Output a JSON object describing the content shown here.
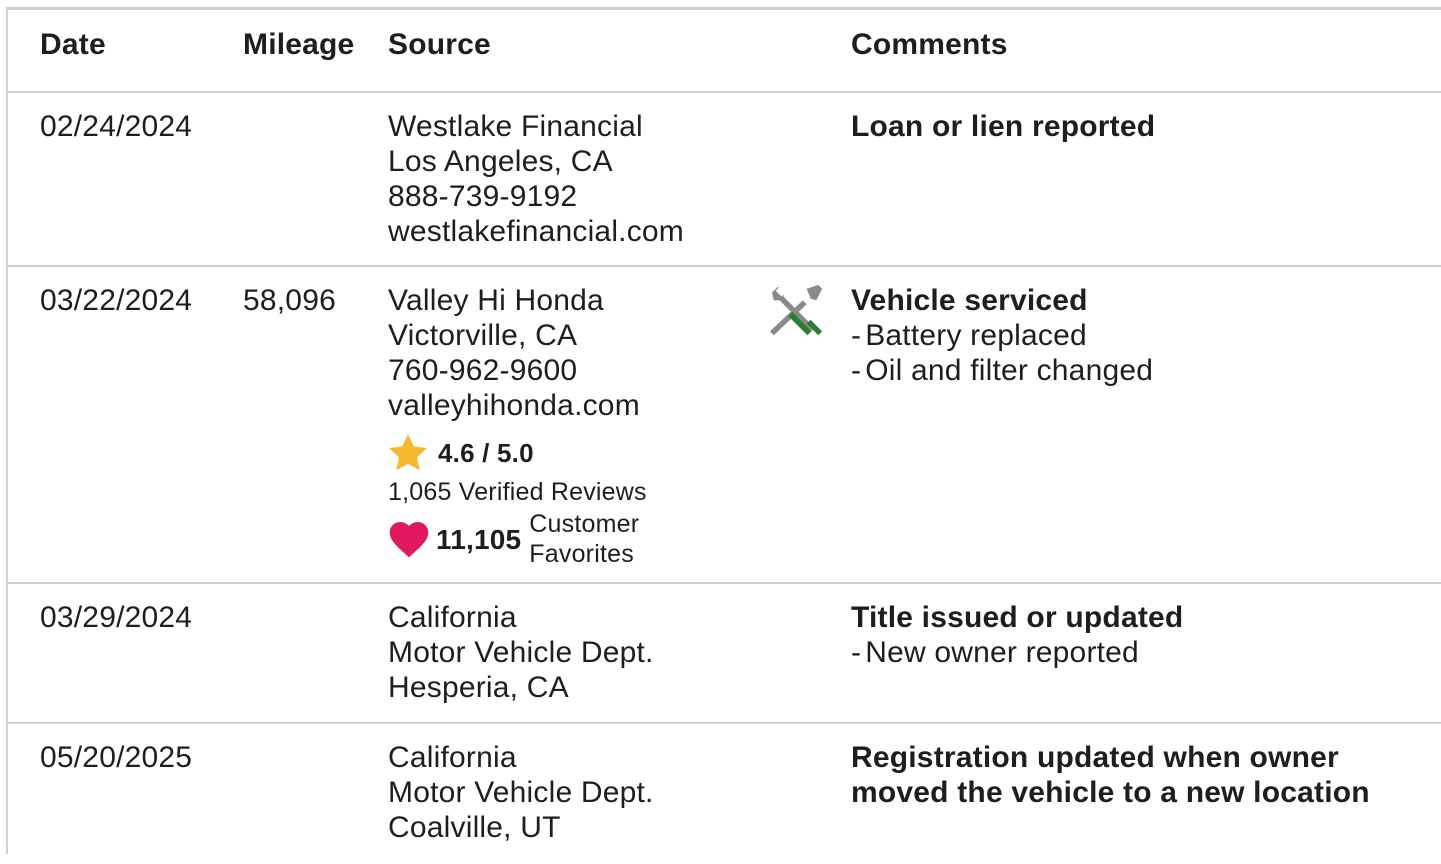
{
  "headers": {
    "date": "Date",
    "mileage": "Mileage",
    "source": "Source",
    "comments": "Comments"
  },
  "records": [
    {
      "date": "02/24/2024",
      "mileage": "",
      "source": [
        "Westlake Financial",
        "Los Angeles, CA",
        "888-739-9192",
        "westlakefinancial.com"
      ],
      "comment_title": "Loan or lien reported",
      "comment_items": []
    },
    {
      "date": "03/22/2024",
      "mileage": "58,096",
      "source": [
        "Valley Hi Honda",
        "Victorville, CA",
        "760-962-9600",
        "valleyhihonda.com"
      ],
      "rating": "4.6 / 5.0",
      "reviews": "1,065 Verified Reviews",
      "favorites_count": "11,105",
      "favorites_label": "Customer Favorites",
      "icon": "wrench-screwdriver-icon",
      "comment_title": "Vehicle serviced",
      "comment_items": [
        "Battery replaced",
        "Oil and filter changed"
      ]
    },
    {
      "date": "03/29/2024",
      "mileage": "",
      "source": [
        "California",
        "Motor Vehicle Dept.",
        "Hesperia, CA"
      ],
      "comment_title": "Title issued or updated",
      "comment_items": [
        "New owner reported"
      ]
    },
    {
      "date": "05/20/2025",
      "mileage": "",
      "source": [
        "California",
        "Motor Vehicle Dept.",
        "Coalville, UT"
      ],
      "comment_title": "Registration updated when owner moved the vehicle to a new location",
      "comment_items": []
    }
  ],
  "bullet_dash": "-",
  "colors": {
    "star": "#f5b82e",
    "heart": "#e0185f",
    "wrench_gray": "#8a8a8a",
    "screwdriver_green": "#2e7d32",
    "divider": "#cfcfcf",
    "text": "#1e1e1e"
  }
}
